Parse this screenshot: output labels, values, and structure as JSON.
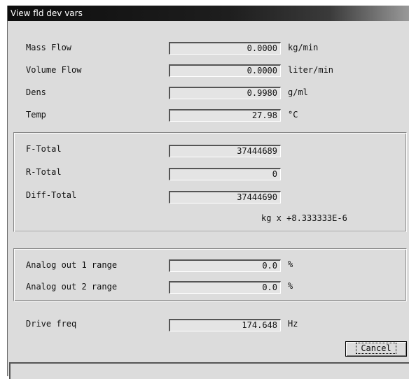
{
  "window": {
    "title": "View fld dev vars"
  },
  "process": [
    {
      "label": "Mass Flow",
      "value": "0.0000",
      "unit": "kg/min"
    },
    {
      "label": "Volume Flow",
      "value": "0.0000",
      "unit": "liter/min"
    },
    {
      "label": "Dens",
      "value": "0.9980",
      "unit": "g/ml"
    },
    {
      "label": "Temp",
      "value": "27.98",
      "unit": "°C"
    }
  ],
  "totals": {
    "items": [
      {
        "label": "F-Total",
        "value": "37444689"
      },
      {
        "label": "R-Total",
        "value": "0"
      },
      {
        "label": "Diff-Total",
        "value": "37444690"
      }
    ],
    "scale": "kg x +8.333333E-6"
  },
  "analog": [
    {
      "label": "Analog out 1 range",
      "value": "0.0",
      "unit": "%"
    },
    {
      "label": "Analog out 2 range",
      "value": "0.0",
      "unit": "%"
    }
  ],
  "drive": {
    "label": "Drive freq",
    "value": "174.648",
    "unit": "Hz"
  },
  "buttons": {
    "cancel": "Cancel"
  }
}
